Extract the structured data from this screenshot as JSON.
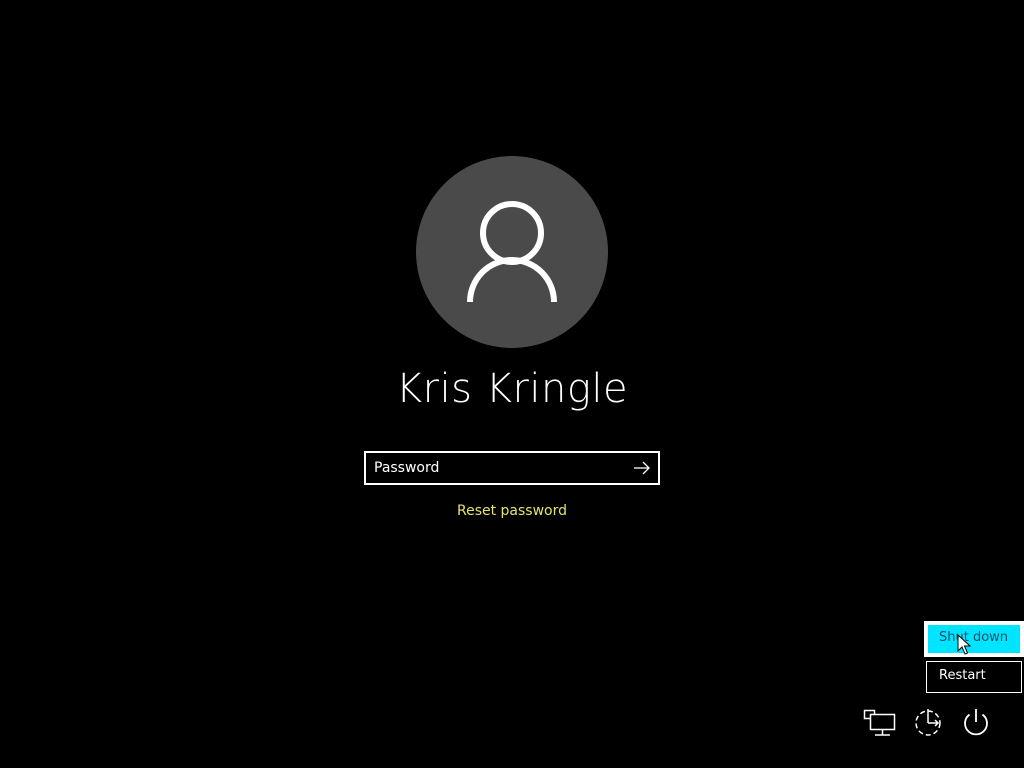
{
  "user": {
    "name": "Kris Kringle"
  },
  "login": {
    "password_placeholder": "Password",
    "reset_label": "Reset password"
  },
  "power_menu": {
    "items": [
      {
        "label": "Shut down",
        "selected": true
      },
      {
        "label": "Restart",
        "selected": false
      }
    ]
  },
  "tray": {
    "icons": [
      "network-icon",
      "ease-of-access-icon",
      "power-icon"
    ]
  },
  "colors": {
    "background": "#000000",
    "avatar": "#4a4a4a",
    "link": "#e3e36e",
    "selected_item": "#00e5ff"
  }
}
